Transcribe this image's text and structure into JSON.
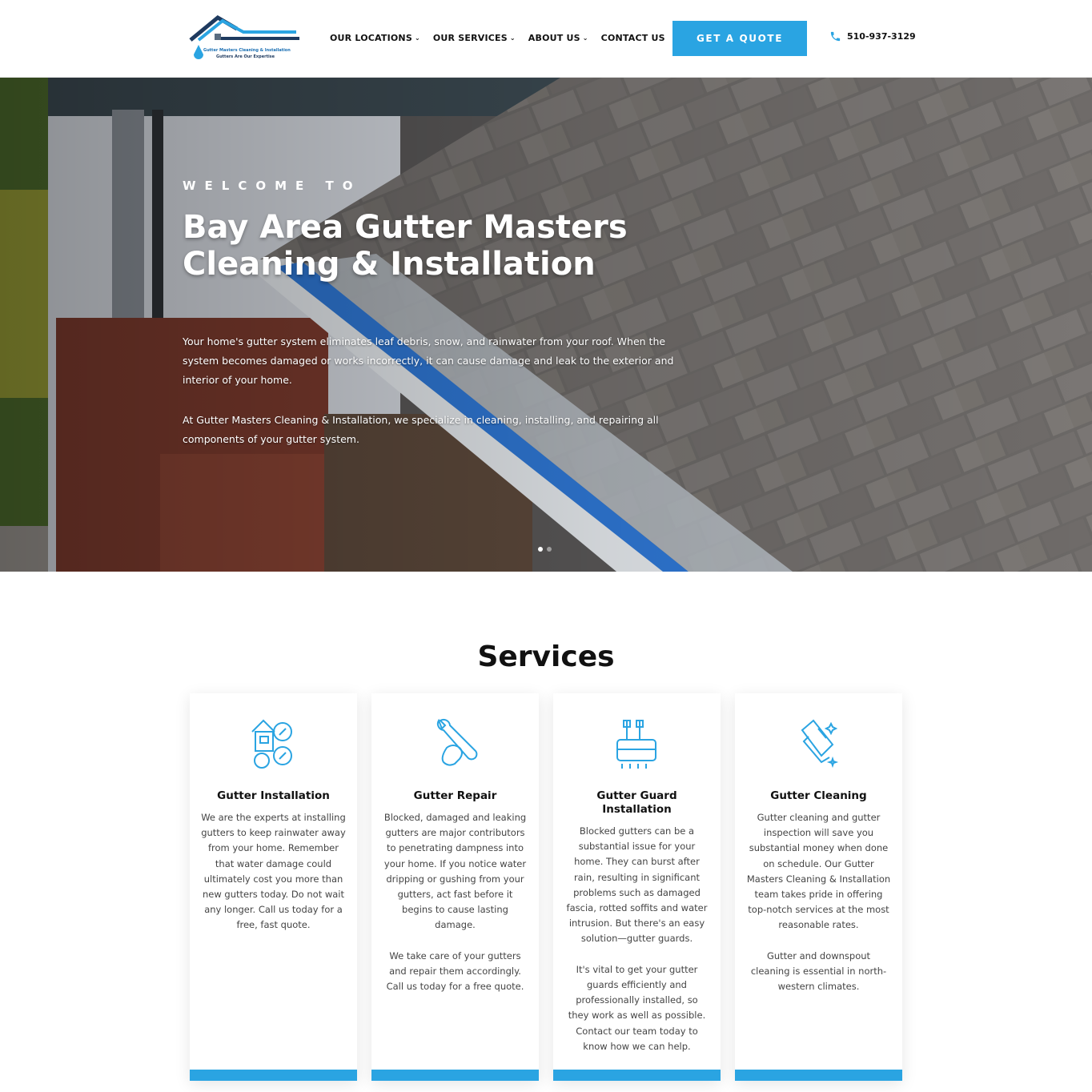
{
  "header": {
    "logo_line1": "Gutter Masters Cleaning & Installation",
    "logo_line2": "Gutters Are Our Expertise",
    "nav": [
      {
        "label": "OUR LOCATIONS",
        "icon": "chevron-down-icon"
      },
      {
        "label": "OUR SERVICES",
        "icon": "chevron-down-icon"
      },
      {
        "label": "ABOUT US",
        "icon": "chevron-down-icon"
      },
      {
        "label": "CONTACT US"
      }
    ],
    "cta_label": "GET A QUOTE",
    "phone": "510-937-3129",
    "accent_color": "#2aa4e2"
  },
  "hero": {
    "kicker": "WELCOME TO",
    "title": "Bay Area Gutter Masters Cleaning & Installation",
    "paragraph1": "Your home's gutter system eliminates leaf debris, snow, and rainwater from your roof. When the system becomes damaged or works incorrectly, it can cause damage and leak to the exterior and interior of your home.",
    "paragraph2": "At Gutter Masters Cleaning & Installation, we specialize in cleaning, installing, and repairing all components of your gutter system.",
    "slides": 2,
    "active_slide": 1
  },
  "services": {
    "title": "Services",
    "items": [
      {
        "name": "Gutter Installation",
        "icon": "house-tools-icon",
        "body": "We are the experts at installing gutters to keep rainwater away from your home. Remember that water damage could ultimately cost you more than new gutters today. Do not wait any longer. Call us today for a free, fast quote."
      },
      {
        "name": "Gutter Repair",
        "icon": "wrench-hand-icon",
        "body": "Blocked, damaged and leaking gutters are major contributors to penetrating dampness into your home. If you notice water dripping or gushing from your gutters, act fast before it begins to cause lasting damage.\n\nWe take care of your gutters and repair them accordingly. Call us today for a free quote."
      },
      {
        "name": "Gutter Guard Installation",
        "icon": "guard-unit-icon",
        "body": "Blocked gutters can be a substantial issue for your home. They can burst after rain, resulting in significant problems such as damaged fascia, rotted soffits and water intrusion. But there's an easy solution—gutter guards.\n\nIt's vital to get your gutter guards efficiently and professionally installed, so they work as well as possible. Contact our team today to know how we can help."
      },
      {
        "name": "Gutter Cleaning",
        "icon": "cleaning-glove-icon",
        "body": "Gutter cleaning and gutter inspection will save you substantial money when done on schedule. Our Gutter Masters Cleaning & Installation team takes pride in offering top-notch services at the most reasonable rates.\n\nGutter and downspout cleaning is essential in north-western climates."
      }
    ]
  }
}
